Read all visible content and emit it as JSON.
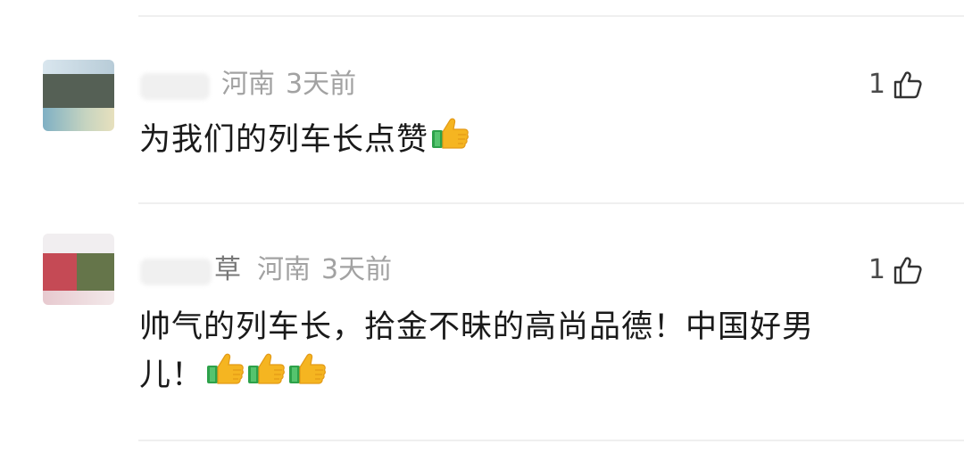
{
  "comments": [
    {
      "avatar": "user-avatar",
      "name_visible_char": "",
      "location": "河南",
      "time": "3天前",
      "likes": "1",
      "text": "为我们的列车长点赞",
      "emoji": [
        "thumbs-up-emoji"
      ]
    },
    {
      "avatar": "user-avatar",
      "name_visible_char": "草",
      "location": "河南",
      "time": "3天前",
      "likes": "1",
      "text_line1": "帅气的列车长，拾金不昧的高尚品德！中国好男",
      "text_line2": "儿！",
      "emoji": [
        "thumbs-up-emoji",
        "thumbs-up-emoji",
        "thumbs-up-emoji"
      ]
    }
  ],
  "icons": {
    "like": "thumb-up-outline-icon"
  }
}
